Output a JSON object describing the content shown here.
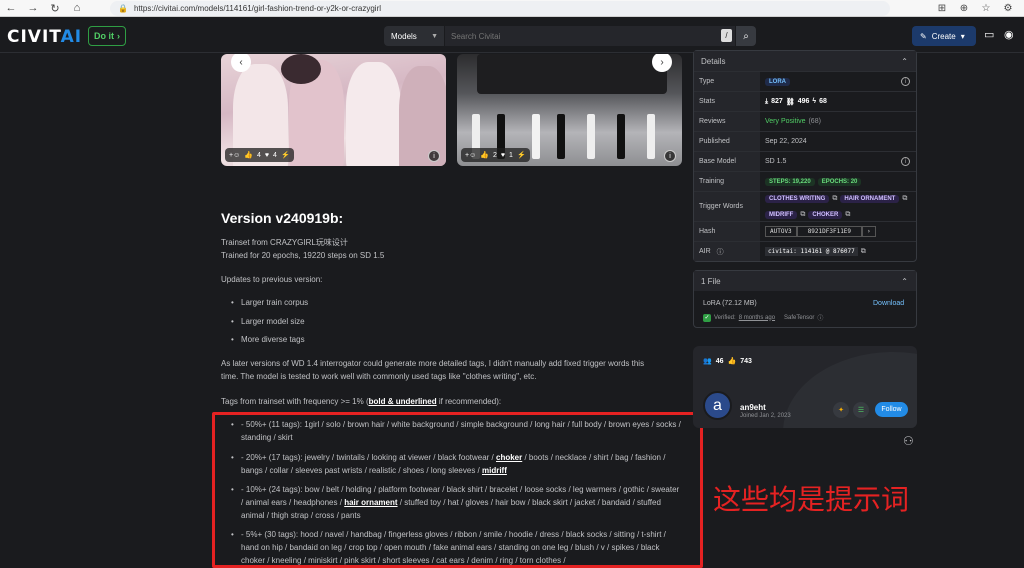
{
  "browser": {
    "url": "https://civitai.com/models/114161/girl-fashion-trend-or-y2k-or-crazygirl"
  },
  "header": {
    "logo_main": "CIVIT",
    "logo_ai": "AI",
    "doit_label": "Do it",
    "models_label": "Models",
    "search_placeholder": "Search Civitai",
    "slash_key": "/",
    "create_label": "Create"
  },
  "images": {
    "left": {
      "bolt": "4",
      "heart": "4"
    },
    "right": {
      "thumb": "2",
      "heart": "1"
    }
  },
  "content": {
    "version_title": "Version v240919b:",
    "trainset_line1": "Trainset from CRAZYGIRL玩味设计",
    "trainset_line2": "Trained for 20 epochs, 19220 steps on SD 1.5",
    "updates_heading": "Updates to previous version:",
    "updates": [
      "Larger train corpus",
      "Larger model size",
      "More diverse tags"
    ],
    "note_line1": "As later versions of WD 1.4 interrogator could generate more detailed tags, I didn't manually add fixed trigger words this",
    "note_line2": "time. The model is tested to work well with commonly used tags like \"clothes writing\", etc.",
    "freq_prefix": "Tags from trainset with frequency >= 1% (",
    "freq_bold": "bold & underlined",
    "freq_suffix": " if recommended):",
    "tags50": "- 50%+ (11 tags): 1girl / solo / brown hair / white background / simple background / long hair / full body / brown eyes / socks / standing / skirt",
    "tags20_a": "- 20%+ (17 tags): jewelry / twintails / looking at viewer / black footwear / ",
    "tags20_b": "choker",
    "tags20_c": " / boots / necklace / shirt / bag / fashion / bangs / collar / sleeves past wrists / realistic / shoes / long sleeves / ",
    "tags20_d": "midriff",
    "tags10_a": "- 10%+ (24 tags): bow / belt / holding / platform footwear / black shirt / bracelet / loose socks / leg warmers / gothic / sweater / animal ears / headphones / ",
    "tags10_b": "hair ornament",
    "tags10_c": " / stuffed toy / hat / gloves / hair bow / black skirt / jacket / bandaid / stuffed animal / thigh strap / cross / pants",
    "tags5": "- 5%+ (30 tags): hood / navel / handbag / fingerless gloves / ribbon / smile / hoodie / dress / black socks / sitting / t-shirt / hand on hip / bandaid on leg / crop top / open mouth / fake animal ears / standing on one leg / blush / v / spikes / black choker / kneeling / miniskirt / pink skirt / short sleeves / cat ears / denim / ring / torn clothes /",
    "annotation": "这些均是提示词"
  },
  "details": {
    "title": "Details",
    "type_k": "Type",
    "type_v": "LORA",
    "stats_k": "Stats",
    "stat_downloads": "827",
    "stat_links": "496",
    "stat_buzz": "68",
    "reviews_k": "Reviews",
    "reviews_v": "Very Positive",
    "reviews_count": "(68)",
    "published_k": "Published",
    "published_v": "Sep 22, 2024",
    "base_k": "Base Model",
    "base_v": "SD 1.5",
    "training_k": "Training",
    "steps": "STEPS: 19,220",
    "epochs": "EPOCHS: 20",
    "trigger_k": "Trigger Words",
    "triggers": [
      "CLOTHES WRITING",
      "HAIR ORNAMENT",
      "MIDRIFF",
      "CHOKER"
    ],
    "hash_k": "Hash",
    "hash_algo": "AUTOV3",
    "hash_v": "8921DF3F11E9",
    "air_k": "AIR",
    "air_v": "civitai: 114161 @ 876077"
  },
  "files": {
    "title": "1 File",
    "file_name": "LoRA (72.12 MB)",
    "download": "Download",
    "verified": "Verified:",
    "verified_when": "8 months ago",
    "safetensor": "SafeTensor"
  },
  "creator": {
    "followers": "46",
    "likes": "743",
    "avatar_letter": "a",
    "name": "an9eht",
    "joined": "Joined Jan 2, 2023",
    "follow": "Follow"
  }
}
